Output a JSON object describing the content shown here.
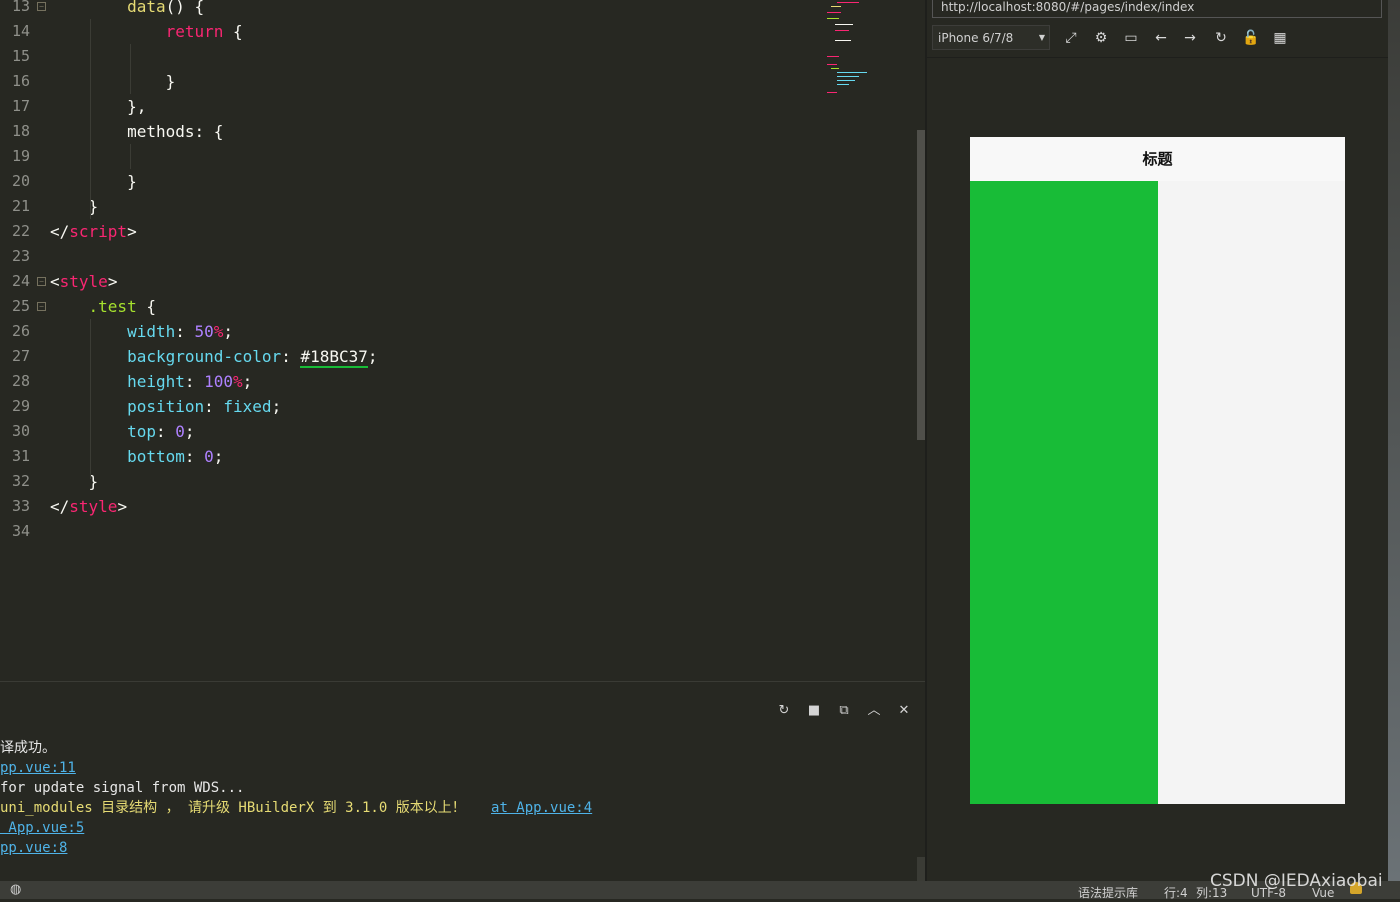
{
  "editor": {
    "lines": [
      {
        "num": "13",
        "fold": true,
        "tokens": [
          [
            "plain",
            "        "
          ],
          [
            "fn",
            "data"
          ],
          [
            "plain",
            "() {"
          ]
        ]
      },
      {
        "num": "14",
        "fold": false,
        "tokens": [
          [
            "plain",
            "            "
          ],
          [
            "kw",
            "return"
          ],
          [
            "plain",
            " {"
          ]
        ]
      },
      {
        "num": "15",
        "fold": false,
        "tokens": []
      },
      {
        "num": "16",
        "fold": false,
        "tokens": [
          [
            "plain",
            "            }"
          ]
        ]
      },
      {
        "num": "17",
        "fold": false,
        "tokens": [
          [
            "plain",
            "        },"
          ]
        ]
      },
      {
        "num": "18",
        "fold": false,
        "tokens": [
          [
            "plain",
            "        methods: {"
          ]
        ]
      },
      {
        "num": "19",
        "fold": false,
        "tokens": []
      },
      {
        "num": "20",
        "fold": false,
        "tokens": [
          [
            "plain",
            "        }"
          ]
        ]
      },
      {
        "num": "21",
        "fold": false,
        "tokens": [
          [
            "plain",
            "    }"
          ]
        ]
      },
      {
        "num": "22",
        "fold": false,
        "tokens": [
          [
            "plain",
            "</"
          ],
          [
            "tag",
            "script"
          ],
          [
            "plain",
            ">"
          ]
        ]
      },
      {
        "num": "23",
        "fold": false,
        "tokens": []
      },
      {
        "num": "24",
        "fold": true,
        "tokens": [
          [
            "plain",
            "<"
          ],
          [
            "tag",
            "style"
          ],
          [
            "plain",
            ">"
          ]
        ]
      },
      {
        "num": "25",
        "fold": true,
        "tokens": [
          [
            "plain",
            "    "
          ],
          [
            "sel",
            ".test"
          ],
          [
            "plain",
            " {"
          ]
        ]
      },
      {
        "num": "26",
        "fold": false,
        "tokens": [
          [
            "plain",
            "        "
          ],
          [
            "prop",
            "width"
          ],
          [
            "plain",
            ": "
          ],
          [
            "num",
            "50"
          ],
          [
            "unit",
            "%"
          ],
          [
            "plain",
            ";"
          ]
        ]
      },
      {
        "num": "27",
        "fold": false,
        "tokens": [
          [
            "plain",
            "        "
          ],
          [
            "prop",
            "background-color"
          ],
          [
            "plain",
            ": "
          ],
          [
            "color",
            "#18BC37"
          ],
          [
            "plain",
            ";"
          ]
        ]
      },
      {
        "num": "28",
        "fold": false,
        "tokens": [
          [
            "plain",
            "        "
          ],
          [
            "prop",
            "height"
          ],
          [
            "plain",
            ": "
          ],
          [
            "num",
            "100"
          ],
          [
            "unit",
            "%"
          ],
          [
            "plain",
            ";"
          ]
        ]
      },
      {
        "num": "29",
        "fold": false,
        "tokens": [
          [
            "plain",
            "        "
          ],
          [
            "prop",
            "position"
          ],
          [
            "plain",
            ": "
          ],
          [
            "val",
            "fixed"
          ],
          [
            "plain",
            ";"
          ]
        ]
      },
      {
        "num": "30",
        "fold": false,
        "tokens": [
          [
            "plain",
            "        "
          ],
          [
            "prop",
            "top"
          ],
          [
            "plain",
            ": "
          ],
          [
            "num",
            "0"
          ],
          [
            "plain",
            ";"
          ]
        ]
      },
      {
        "num": "31",
        "fold": false,
        "tokens": [
          [
            "plain",
            "        "
          ],
          [
            "prop",
            "bottom"
          ],
          [
            "plain",
            ": "
          ],
          [
            "num",
            "0"
          ],
          [
            "plain",
            ";"
          ]
        ]
      },
      {
        "num": "32",
        "fold": false,
        "tokens": [
          [
            "plain",
            "    }"
          ]
        ]
      },
      {
        "num": "33",
        "fold": false,
        "tokens": [
          [
            "plain",
            "</"
          ],
          [
            "tag",
            "style"
          ],
          [
            "plain",
            ">"
          ]
        ]
      },
      {
        "num": "34",
        "fold": false,
        "tokens": []
      }
    ]
  },
  "console": {
    "toolbar": {
      "restart_icon": "↻",
      "stop_icon": "■",
      "clear_icon": "⧉",
      "collapse_icon": "︿",
      "close_icon": "✕"
    },
    "lines": [
      [
        [
          "white",
          "译成功。"
        ]
      ],
      [
        [
          "link",
          "pp.vue:11"
        ]
      ],
      [
        [
          "white",
          "for update signal from WDS..."
        ]
      ],
      [
        [
          "yellow",
          "uni_modules 目录结构 ， 请升级 HBuilderX 到 3.1.0 版本以上！   "
        ],
        [
          "link",
          "at App.vue:4"
        ]
      ],
      [
        [
          "link",
          " App.vue:5"
        ]
      ],
      [
        [
          "link",
          "pp.vue:8"
        ]
      ]
    ]
  },
  "preview": {
    "url": "http://localhost:8080/#/pages/index/index",
    "device": "iPhone 6/7/8",
    "toolbar_icons": [
      "rotate-icon",
      "settings-icon",
      "console-icon",
      "back-icon",
      "forward-icon",
      "refresh-icon",
      "lock-icon",
      "qrcode-icon"
    ],
    "toolbar_glyphs": [
      "⤢",
      "⚙",
      "▭",
      "←",
      "→",
      "↻",
      "🔓",
      "▦"
    ],
    "page_title": "标题",
    "test_block_color": "#18BC37"
  },
  "statusbar": {
    "syntax_lib": "语法提示库",
    "line": "行:4",
    "col": "列:13",
    "encoding": "UTF-8",
    "language": "Vue",
    "watermark": "CSDN @IEDAxiaobai"
  }
}
